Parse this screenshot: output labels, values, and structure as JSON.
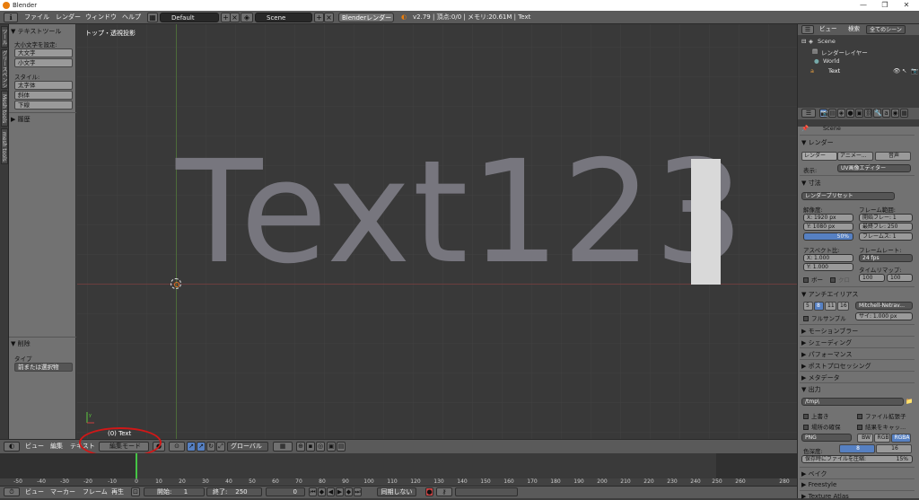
{
  "window": {
    "title": "Blender"
  },
  "menu": {
    "file": "ファイル",
    "render": "レンダー",
    "window": "ウィンドウ",
    "help": "ヘルプ"
  },
  "infobar": {
    "layout": "Default",
    "scene": "Scene",
    "engine": "Blenderレンダー",
    "version": "v2.79 | 頂点:0/0 | メモリ:20.61M | Text"
  },
  "toolshelf": {
    "section_text": "▼ テキストツール",
    "case_label": "大小文字を設定:",
    "upper_btn": "大文字",
    "lower_btn": "小文字",
    "style_label": "スタイル:",
    "bold_btn": "太字体",
    "italic_btn": "斜体",
    "underline_btn": "下線",
    "history": "▶ 履歴",
    "delete_section": "▼ 削除",
    "type_label": "タイプ",
    "type_value": "前または選択物"
  },
  "lefttabs": [
    "ツール",
    "グリースペンシル",
    "Mesh tools",
    "mesh tools"
  ],
  "viewport": {
    "view_label": "トップ・透視投影",
    "text_content": "Text123",
    "object_label": "(0) Text"
  },
  "viewheader": {
    "view": "ビュー",
    "edit": "編集",
    "text": "テキスト",
    "mode": "編集モード",
    "orientation": "グローバル"
  },
  "timeline": {
    "ticks": [
      "-50",
      "-40",
      "-30",
      "-20",
      "-10",
      "0",
      "10",
      "20",
      "30",
      "40",
      "50",
      "60",
      "70",
      "80",
      "90",
      "100",
      "110",
      "120",
      "130",
      "140",
      "150",
      "160",
      "170",
      "180",
      "190",
      "200",
      "210",
      "220",
      "230",
      "240",
      "250",
      "260",
      "280"
    ],
    "view": "ビュー",
    "marker": "マーカー",
    "frame": "フレーム",
    "play": "再生",
    "start_label": "開始:",
    "start": "1",
    "end_label": "終了:",
    "end": "250",
    "current": "0",
    "sync": "同期しない"
  },
  "outliner": {
    "view": "ビュー",
    "search": "検索",
    "filter": "全てのシーン",
    "scene": "Scene",
    "render_layers": "レンダーレイヤー",
    "world": "World",
    "text": "Text"
  },
  "properties": {
    "scene": "Scene",
    "render_section": "▼ レンダー",
    "render_btn": "レンダー",
    "anim_btn": "アニメー...",
    "audio_btn": "音声",
    "display_label": "表示:",
    "display_value": "UV画像エディター",
    "dims_section": "▼ 寸法",
    "preset": "レンダープリセット",
    "resolution_label": "解像度:",
    "res_x": "X:    1920 px",
    "res_y": "Y:    1080 px",
    "res_pct": "50%",
    "frame_range_label": "フレーム範囲:",
    "frame_start": "開始フレー: 1",
    "frame_end": "最終フレ: 250",
    "frame_step": "フレームス: 1",
    "aspect_label": "アスペクト比:",
    "aspect_x": "X:      1.000",
    "aspect_y": "Y:      1.000",
    "framerate_label": "フレームレート:",
    "framerate": "24 fps",
    "timemap_label": "タイムリマップ:",
    "timemap_old": "100",
    "timemap_new": "100",
    "border": "ボー",
    "crop": "クロ",
    "aa_section": "▼ アンチエイリアス",
    "aa_5": "5",
    "aa_8": "8",
    "aa_11": "11",
    "aa_16": "16",
    "aa_filter": "Mitchell-Netrav...",
    "fullsample": "フルサンプル",
    "size": "サイ: 1.000 px",
    "motionblur": "▶ モーションブラー",
    "shading": "▶ シェーディング",
    "performance": "▶ パフォーマンス",
    "postprocessing": "▶ ポストプロセッシング",
    "metadata": "▶ メタデータ",
    "output_section": "▼ 出力",
    "output_path": "/tmp\\",
    "overwrite": "上書き",
    "file_ext": "ファイル拡張子",
    "placeholders": "場所の確保",
    "cache_result": "結果をキャッ...",
    "format": "PNG",
    "bw": "BW",
    "rgb": "RGB",
    "rgba": "RGBA",
    "color_depth_label": "色深度:",
    "depth_8": "8",
    "depth_16": "16",
    "compression": "保存時にファイルを圧縮:",
    "compression_value": "15%",
    "bake": "▶ ベイク",
    "freestyle": "▶ Freestyle",
    "texture_atlas": "▶ Texture Atlas"
  },
  "colors": {
    "accent": "#5680c2",
    "highlight_circle": "#d01818",
    "text_mesh": "#77767e",
    "playhead": "#45c445"
  }
}
